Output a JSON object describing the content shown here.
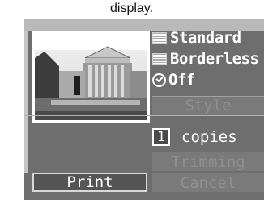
{
  "header": {
    "title_fragment": "display."
  },
  "photo": {
    "subject": "building with columns"
  },
  "settings": {
    "paper": "Standard",
    "layout": "Borderless",
    "date_stamp": "Off"
  },
  "buttons": {
    "style": "Style",
    "trimming": "Trimming",
    "cancel": "Cancel",
    "print": "Print"
  },
  "copies": {
    "count": "1",
    "label": "copies"
  }
}
